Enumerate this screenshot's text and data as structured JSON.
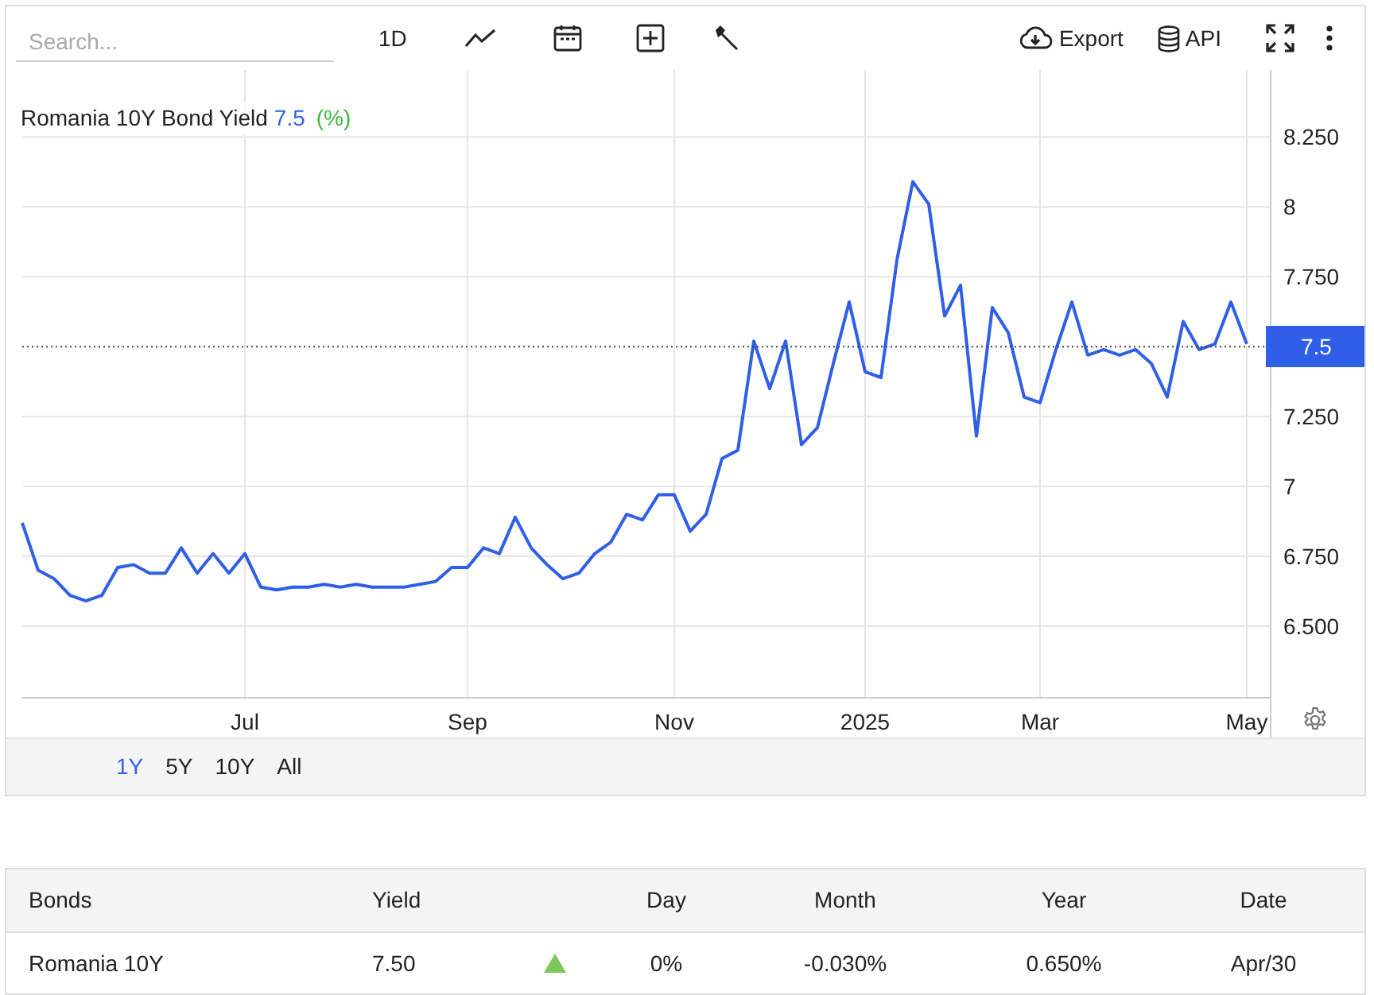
{
  "toolbar": {
    "search": {
      "placeholder": "Search..."
    },
    "interval": "1D",
    "export": "Export",
    "api": "API"
  },
  "chart": {
    "title": "Romania 10Y Bond Yield",
    "current": "7.5",
    "unit": "(%)",
    "current_badge": "7.5",
    "chart_data": {
      "type": "line",
      "categories": [
        null,
        null,
        null,
        null,
        null,
        null,
        null,
        null,
        null,
        null,
        null,
        null,
        null,
        null,
        "Jul",
        null,
        null,
        null,
        null,
        null,
        null,
        null,
        null,
        null,
        null,
        null,
        null,
        null,
        "Sep",
        null,
        null,
        null,
        null,
        null,
        null,
        null,
        null,
        null,
        null,
        null,
        null,
        "Nov",
        null,
        null,
        null,
        null,
        null,
        null,
        null,
        null,
        null,
        null,
        null,
        "2025",
        null,
        null,
        null,
        null,
        null,
        null,
        null,
        null,
        null,
        null,
        "Mar",
        null,
        null,
        null,
        null,
        null,
        null,
        null,
        null,
        null,
        null,
        null,
        null,
        "May"
      ],
      "series": [
        {
          "color": "#2f5fe8",
          "values": [
            6.87,
            6.7,
            6.67,
            6.61,
            6.59,
            6.61,
            6.71,
            6.72,
            6.69,
            6.69,
            6.78,
            6.69,
            6.76,
            6.69,
            6.76,
            6.64,
            6.63,
            6.64,
            6.64,
            6.65,
            6.64,
            6.65,
            6.64,
            6.64,
            6.64,
            6.65,
            6.66,
            6.71,
            6.71,
            6.78,
            6.76,
            6.89,
            6.78,
            6.72,
            6.67,
            6.69,
            6.76,
            6.8,
            6.9,
            6.88,
            6.97,
            6.97,
            6.84,
            6.9,
            7.1,
            7.13,
            7.52,
            7.35,
            7.52,
            7.15,
            7.21,
            7.44,
            7.66,
            7.41,
            7.39,
            7.81,
            8.09,
            8.01,
            7.61,
            7.72,
            7.18,
            7.64,
            7.55,
            7.32,
            7.3,
            7.49,
            7.66,
            7.47,
            7.49,
            7.47,
            7.49,
            7.44,
            7.32,
            7.59,
            7.49,
            7.51,
            7.66,
            7.51
          ]
        }
      ],
      "ylim": [
        6.244,
        8.49
      ],
      "grid": true,
      "ref_lines": [
        {
          "axis": "y",
          "value": 7.5
        }
      ],
      "yticks": [
        {
          "value": 6.5,
          "label": "6.500"
        },
        {
          "value": 6.75,
          "label": "6.750"
        },
        {
          "value": 7,
          "label": "7"
        },
        {
          "value": 7.25,
          "label": "7.250"
        },
        {
          "value": 7.75,
          "label": "7.750"
        },
        {
          "value": 8,
          "label": "8"
        },
        {
          "value": 8.25,
          "label": "8.250"
        }
      ]
    }
  },
  "ranges": [
    {
      "label": "1Y",
      "selected": true
    },
    {
      "label": "5Y",
      "selected": false
    },
    {
      "label": "10Y",
      "selected": false
    },
    {
      "label": "All",
      "selected": false
    }
  ],
  "table": {
    "columns": [
      "Bonds",
      "Yield",
      "",
      "Day",
      "Month",
      "Year",
      "Date"
    ],
    "rows": [
      {
        "cells": [
          "Romania 10Y",
          "7.50",
          "",
          "0%",
          "-0.030%",
          "0.650%",
          "Apr/30"
        ],
        "trend_up": true
      }
    ]
  }
}
